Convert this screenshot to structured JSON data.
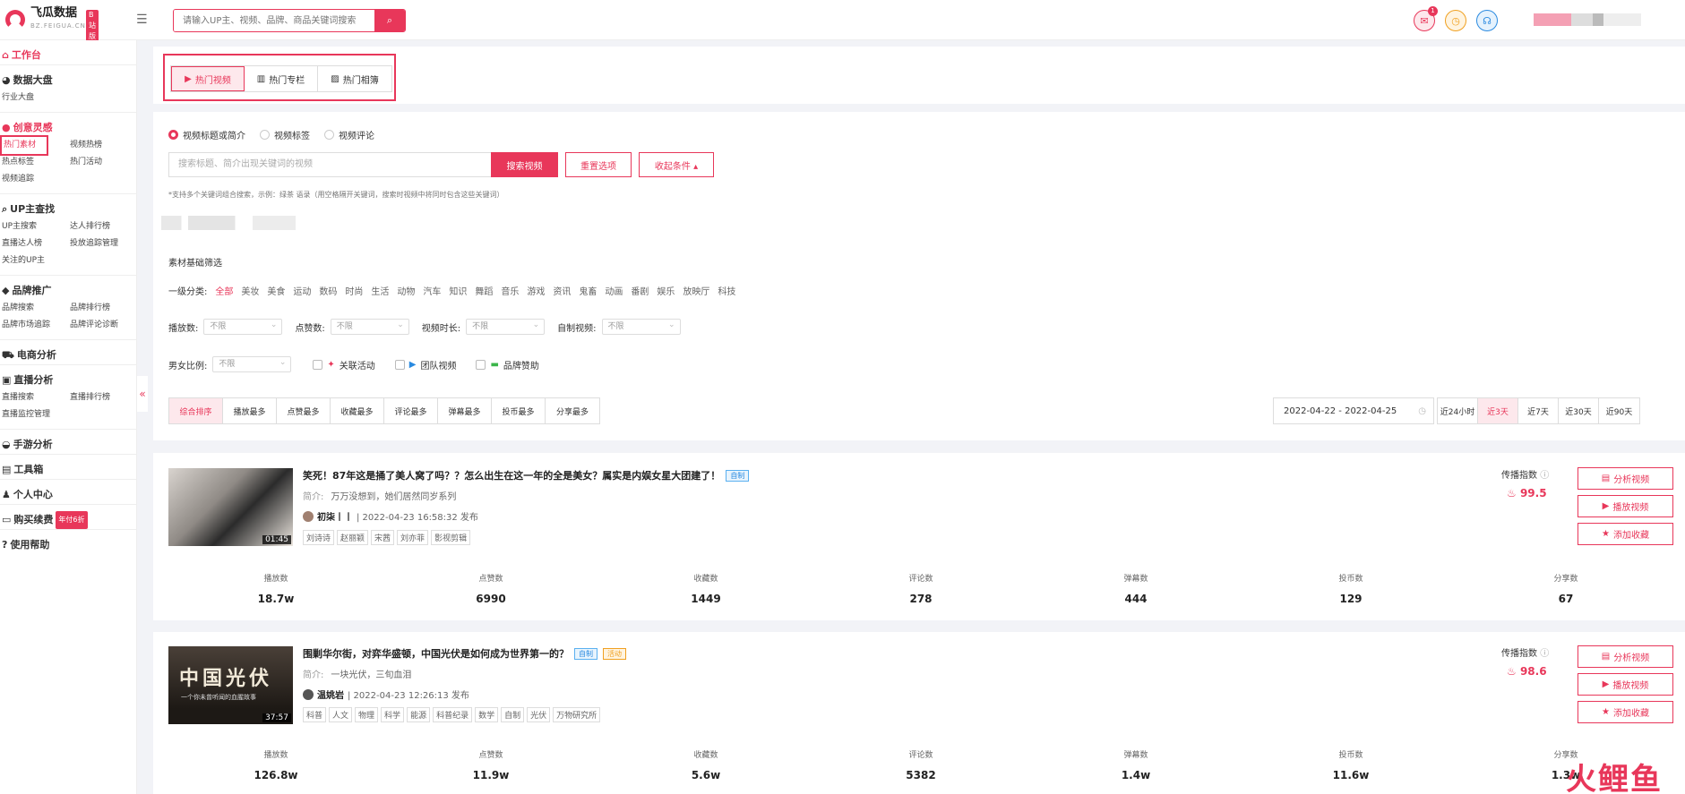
{
  "logo": {
    "name": "飞瓜数据",
    "sub": "BZ.FEIGUA.CN",
    "badge": "B站版"
  },
  "search": {
    "placeholder": "请输入UP主、视频、品牌、商品关键词搜索"
  },
  "notify_count": "1",
  "sidebar": {
    "workspace": "工作台",
    "groups": [
      {
        "title": "数据大盘",
        "items": [
          "行业大盘"
        ]
      },
      {
        "title": "创意灵感",
        "items": [
          "热门素材",
          "视频热榜",
          "热点标签",
          "热门活动",
          "视频追踪"
        ]
      },
      {
        "title": "UP主查找",
        "items": [
          "UP主搜索",
          "达人排行榜",
          "直播达人榜",
          "投放追踪管理",
          "关注的UP主"
        ]
      },
      {
        "title": "品牌推广",
        "items": [
          "品牌搜索",
          "品牌排行榜",
          "品牌市场追踪",
          "品牌评论诊断"
        ]
      },
      {
        "title": "电商分析",
        "items": []
      },
      {
        "title": "直播分析",
        "items": [
          "直播搜索",
          "直播排行榜",
          "直播监控管理"
        ]
      },
      {
        "title": "手游分析",
        "items": []
      },
      {
        "title": "工具箱",
        "items": []
      },
      {
        "title": "个人中心",
        "items": []
      }
    ],
    "buy": "购买续费",
    "buy_badge": "年付6折",
    "help": "使用帮助"
  },
  "tabs": [
    "热门视频",
    "热门专栏",
    "热门相簿"
  ],
  "radios": [
    "视频标题或简介",
    "视频标签",
    "视频评论"
  ],
  "keyword_placeholder": "搜索标题、简介出现关键词的视频",
  "buttons": {
    "search": "搜索视频",
    "reset": "重置选项",
    "collapse": "收起条件 ▴"
  },
  "hint": "*支持多个关键词组合搜索，示例：绿茶 语录（用空格隔开关键词，搜索时视频中将同时包含这些关键词）",
  "filter_title": "素材基础筛选",
  "category": {
    "label": "一级分类:",
    "items": [
      "全部",
      "美妆",
      "美食",
      "运动",
      "数码",
      "时尚",
      "生活",
      "动物",
      "汽车",
      "知识",
      "舞蹈",
      "音乐",
      "游戏",
      "资讯",
      "鬼畜",
      "动画",
      "番剧",
      "娱乐",
      "放映厅",
      "科技"
    ]
  },
  "selects1": [
    {
      "label": "播放数:",
      "value": "不限"
    },
    {
      "label": "点赞数:",
      "value": "不限"
    },
    {
      "label": "视频时长:",
      "value": "不限"
    },
    {
      "label": "自制视频:",
      "value": "不限"
    }
  ],
  "gender": {
    "label": "男女比例:",
    "value": "不限"
  },
  "checks": [
    "关联活动",
    "团队视频",
    "品牌赞助"
  ],
  "sorts": [
    "综合排序",
    "播放最多",
    "点赞最多",
    "收藏最多",
    "评论最多",
    "弹幕最多",
    "投币最多",
    "分享最多"
  ],
  "date_range": "2022-04-22 - 2022-04-25",
  "ranges": [
    "近24小时",
    "近3天",
    "近7天",
    "近30天",
    "近90天"
  ],
  "videos": [
    {
      "title": "笑死！87年这是捅了美人窝了吗？？怎么出生在这一年的全是美女？属实是内娱女星大团建了！",
      "tags_label": [
        "自制"
      ],
      "desc_key": "简介:",
      "desc": "万万没想到，她们居然同岁系列",
      "author": "初柒丨丨",
      "time": "| 2022-04-23 16:58:32 发布",
      "tags": [
        "刘诗诗",
        "赵丽颖",
        "宋茜",
        "刘亦菲",
        "影视剪辑"
      ],
      "duration": "01:45",
      "spread_label": "传播指数",
      "spread": "99.5",
      "stats": [
        [
          "播放数",
          "18.7w"
        ],
        [
          "点赞数",
          "6990"
        ],
        [
          "收藏数",
          "1449"
        ],
        [
          "评论数",
          "278"
        ],
        [
          "弹幕数",
          "444"
        ],
        [
          "投币数",
          "129"
        ],
        [
          "分享数",
          "67"
        ]
      ]
    },
    {
      "title": "围剿华尔街，对弈华盛顿，中国光伏是如何成为世界第一的？",
      "tags_label": [
        "自制",
        "活动"
      ],
      "desc_key": "简介:",
      "desc": "一块光伏，三旬血泪",
      "author": "温姚岩",
      "time": "| 2022-04-23 12:26:13 发布",
      "tags": [
        "科普",
        "人文",
        "物理",
        "科学",
        "能源",
        "科普纪录",
        "数学",
        "自制",
        "光伏",
        "万物研究所"
      ],
      "duration": "37:57",
      "thumb_title": "中国光伏",
      "thumb_sub": "一个你未曾听闻的血腥故事",
      "spread_label": "传播指数",
      "spread": "98.6",
      "stats": [
        [
          "播放数",
          "126.8w"
        ],
        [
          "点赞数",
          "11.9w"
        ],
        [
          "收藏数",
          "5.6w"
        ],
        [
          "评论数",
          "5382"
        ],
        [
          "弹幕数",
          "1.4w"
        ],
        [
          "投币数",
          "11.6w"
        ],
        [
          "分享数",
          "1.3w"
        ]
      ]
    }
  ],
  "actions": [
    "分析视频",
    "播放视频",
    "添加收藏"
  ],
  "watermark": "火鲤鱼"
}
